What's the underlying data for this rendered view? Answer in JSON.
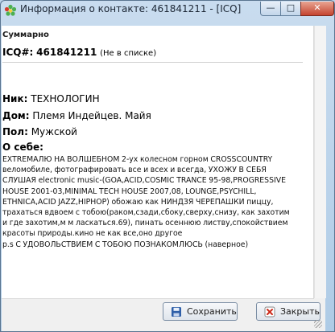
{
  "window": {
    "title": "Информация о контакте:  461841211 - [ICQ]",
    "controls": {
      "minimize": "—",
      "maximize": "□",
      "close": "✕"
    }
  },
  "summary": {
    "header": "Суммарно",
    "icq_label": "ICQ#:",
    "icq_number": "461841211",
    "icq_note": "(Не в списке)"
  },
  "fields": [
    {
      "label": "Ник:",
      "value": "ТЕХНОЛОГИН"
    },
    {
      "label": "Дом:",
      "value": "Племя Индейцев. Майя"
    },
    {
      "label": "Пол:",
      "value": "Мужской"
    }
  ],
  "about": {
    "label": "О себе:",
    "lines": [
      "EXTREMAЛЮ НА ВОЛШЕБНОМ 2-ух колесном горном CROSSCOUNTRY",
      "веломобиле, фотографировать все и всех и всегда, УХОЖУ В СЕБЯ",
      "СЛУШАЯ electronic music-(GOA,ACID,COSMIC TRANCE 95-98,PROGRESSIVE",
      "HOUSE 2001-03,MINIMAL TECH HOUSE 2007,08, LOUNGE,PSYCHILL,",
      "ETHNICA,ACID JAZZ,HIPHOP) обожаю как НИНДЗЯ ЧЕРЕПАШКИ пиццу,",
      "трахаться вдвоем с тобою(раком,сзади,сбоку,сверху,снизу, как захотим",
      "и где захотим,м м ласкаться.69), пинать осеннюю листву,спокойствием",
      "красоты природы.кино не как все,оно другое",
      "p.s С УДОВОЛЬСТВИЕМ С ТОБОЮ ПОЗНАКОМЛЮСЬ (наверное)"
    ]
  },
  "buttons": {
    "save_label": "Сохранить",
    "close_label": "Закрыть",
    "save_icon": "save-icon",
    "close_icon": "close-icon"
  },
  "colors": {
    "titlebar": "#c9dcef",
    "close_button": "#c5432f",
    "close_icon_red": "#cc2a1a",
    "save_icon_blue": "#2f5fa8"
  }
}
